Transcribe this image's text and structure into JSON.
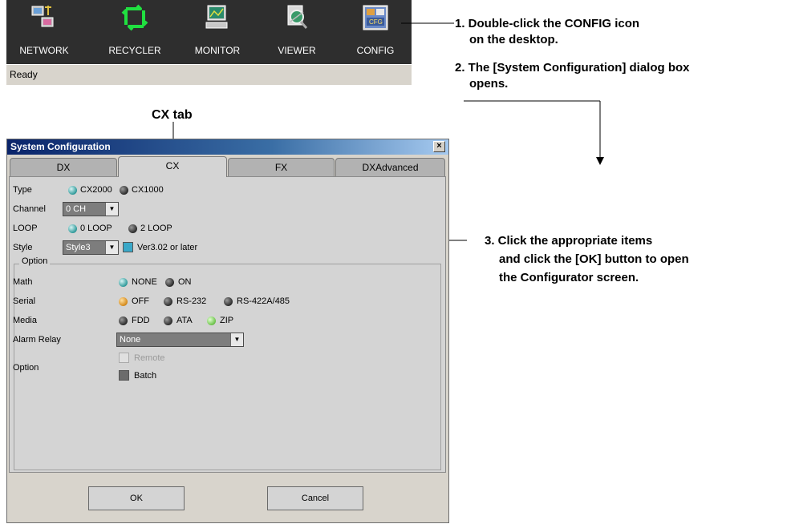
{
  "desktop": {
    "icons": [
      {
        "label": "NETWORK",
        "icon": "network-icon"
      },
      {
        "label": "RECYCLER",
        "icon": "recycler-icon"
      },
      {
        "label": "MONITOR",
        "icon": "monitor-icon"
      },
      {
        "label": "VIEWER",
        "icon": "viewer-icon"
      },
      {
        "label": "CONFIG",
        "icon": "config-icon"
      }
    ],
    "status": "Ready"
  },
  "annotations": {
    "step1_line1": "1. Double-click the CONFIG icon",
    "step1_line2": "on the desktop.",
    "step2_line1": "2. The [System Configuration] dialog box",
    "step2_line2": "opens.",
    "step3_line1": "3. Click the appropriate items",
    "step3_line2": "and click the [OK] button to open",
    "step3_line3": "the Configurator screen.",
    "tab_caption": "CX tab"
  },
  "dialog": {
    "title": "System Configuration",
    "close": "×",
    "tabs": [
      "DX",
      "CX",
      "FX",
      "DXAdvanced"
    ],
    "active_tab": "CX",
    "type": {
      "label": "Type",
      "options": [
        "CX2000",
        "CX1000"
      ],
      "selected": "CX2000"
    },
    "channel": {
      "label": "Channel",
      "value": "0 CH"
    },
    "loop": {
      "label": "LOOP",
      "options": [
        "0 LOOP",
        "2 LOOP"
      ],
      "selected": "0 LOOP"
    },
    "style": {
      "label": "Style",
      "value": "Style3",
      "checkbox_label": "Ver3.02 or later",
      "checked": true
    },
    "option_group": {
      "legend": "Option",
      "math": {
        "label": "Math",
        "options": [
          "NONE",
          "ON"
        ],
        "selected": "NONE"
      },
      "serial": {
        "label": "Serial",
        "options": [
          "OFF",
          "RS-232",
          "RS-422A/485"
        ],
        "selected": "OFF"
      },
      "media": {
        "label": "Media",
        "options": [
          "FDD",
          "ATA",
          "ZIP"
        ],
        "selected": "ZIP"
      },
      "alarm_relay": {
        "label": "Alarm Relay",
        "value": "None"
      },
      "option": {
        "label": "Option",
        "remote_label": "Remote",
        "batch_label": "Batch"
      }
    },
    "buttons": {
      "ok": "OK",
      "cancel": "Cancel"
    }
  },
  "colors": {
    "title_bar": "#0a246a",
    "selected_radio": "#2f9a9a",
    "serial_selected": "#d4891a",
    "media_selected": "#6cc24a"
  }
}
